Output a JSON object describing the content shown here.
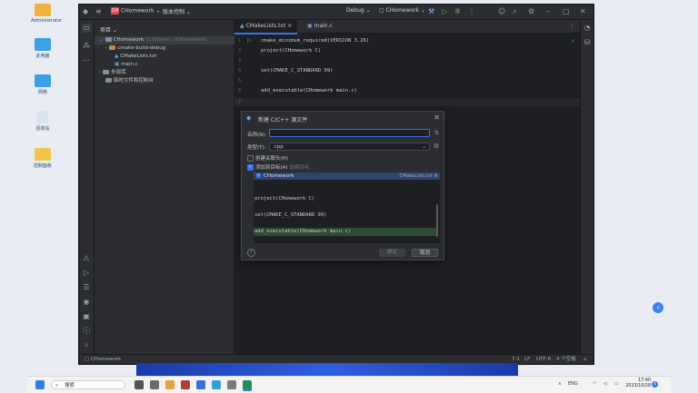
{
  "desktop": {
    "icons": [
      {
        "label": "Administrator",
        "color": "#f2b33d"
      },
      {
        "label": "此电脑",
        "color": "#3aa0e8"
      },
      {
        "label": "网络",
        "color": "#3aa0e8"
      },
      {
        "label": "回收站",
        "color": "#d8e3ee"
      },
      {
        "label": "控制面板",
        "color": "#f2c64d"
      }
    ]
  },
  "window": {
    "titlebar": {
      "project_badge": "CH",
      "project_name": "CHomework",
      "vcs_menu": "版本控制",
      "build_config": "Debug",
      "run_target": "CHomework"
    },
    "project_panel": {
      "header": "项目",
      "tree": [
        {
          "label": "CHomework",
          "path": "C:\\Users\\...\\CHomework",
          "level": 0
        },
        {
          "label": "cmake-build-debug",
          "level": 1
        },
        {
          "label": "CMakeLists.txt",
          "level": 2
        },
        {
          "label": "main.c",
          "level": 2
        },
        {
          "label": "外部库",
          "level": 0
        },
        {
          "label": "临时文件和控制台",
          "level": 0
        }
      ]
    },
    "tabs": [
      {
        "label": "CMakeLists.txt"
      },
      {
        "label": "main.c"
      }
    ],
    "code_lines": [
      {
        "n": "1",
        "text": "cmake_minimum_required(VERSION 3.26)"
      },
      {
        "n": "2",
        "text": "project(CHomework C)"
      },
      {
        "n": "3",
        "text": ""
      },
      {
        "n": "4",
        "text": "set(CMAKE_C_STANDARD 99)"
      },
      {
        "n": "5",
        "text": ""
      },
      {
        "n": "6",
        "text": "add_executable(CHomework main.c)"
      },
      {
        "n": "7",
        "text": ""
      }
    ],
    "statusbar": {
      "project": "CHomework",
      "position": "7:1",
      "line_sep": "LF",
      "encoding": "UTF-8",
      "indent": "4 个空格"
    }
  },
  "dialog": {
    "title": "新建 C/C++ 源文件",
    "name_label": "名称(N):",
    "name_value": "",
    "type_label": "类型(T):",
    "type_value": ".cpp",
    "create_header_label": "创建关联头(H)",
    "add_to_target_label": "添加到目标(A)",
    "select_target_link": "选择目标...",
    "target_item": "CHomework",
    "target_file": "CMakeLists.txt",
    "preview": [
      "project(CHomework C)",
      "",
      "set(CMAKE_C_STANDARD 99)",
      "",
      "add_executable(CHomework main.c)"
    ],
    "ok_label": "确定",
    "cancel_label": "取消",
    "help_label": "?"
  },
  "taskbar": {
    "search_placeholder": "搜索",
    "lang": "ENG",
    "time": "17:40",
    "date": "2023/10/28",
    "notif_count": "4"
  },
  "colors": {
    "accent": "#3574f0",
    "editor_bg": "#1e1f22",
    "panel_bg": "#2b2d30",
    "added_line": "#2d4a32"
  }
}
